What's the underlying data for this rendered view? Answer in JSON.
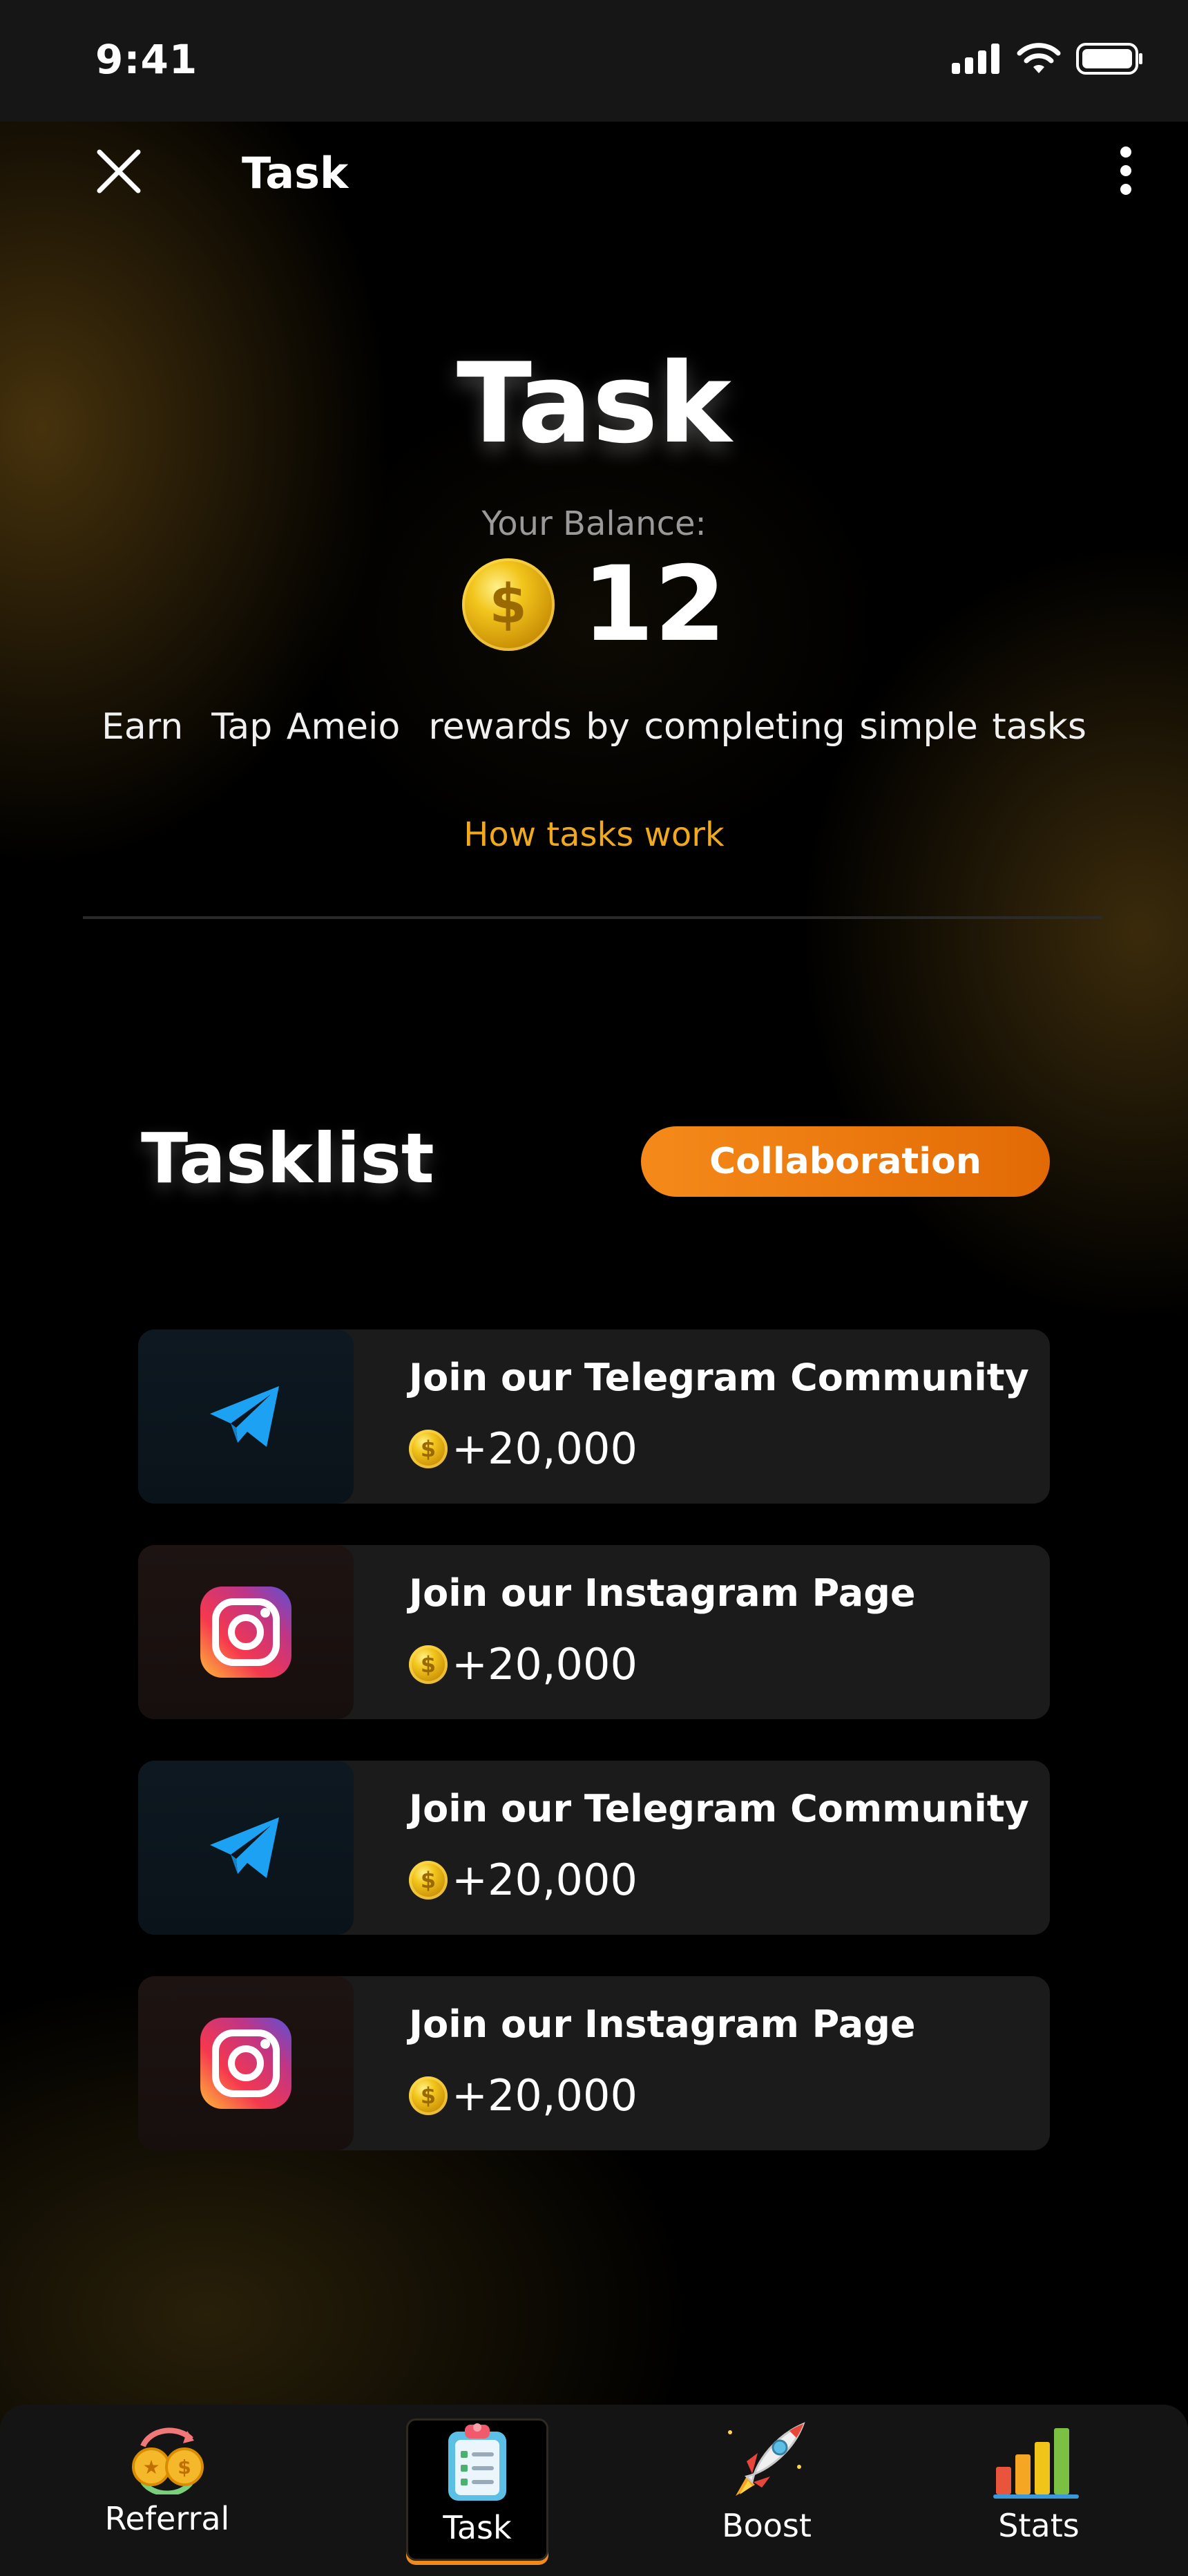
{
  "status_bar": {
    "time": "9:41"
  },
  "header": {
    "title": "Task"
  },
  "hero": {
    "title": "Task",
    "balance_label": "Your Balance:",
    "balance_value": "12",
    "subtitle": "Earn  Tap Ameio  rewards by completing simple tasks",
    "how_link": "How tasks work"
  },
  "tasklist": {
    "title": "Tasklist",
    "filter_label": "Collaboration",
    "items": [
      {
        "icon": "telegram-icon",
        "title": "Join our Telegram Community",
        "reward": "+20,000"
      },
      {
        "icon": "instagram-icon",
        "title": "Join our Instagram Page",
        "reward": "+20,000"
      },
      {
        "icon": "telegram-icon",
        "title": "Join our Telegram Community",
        "reward": "+20,000"
      },
      {
        "icon": "instagram-icon",
        "title": "Join our Instagram Page",
        "reward": "+20,000"
      }
    ]
  },
  "bottom_nav": {
    "items": [
      {
        "label": "Referral",
        "icon": "referral-coins-icon"
      },
      {
        "label": "Task",
        "icon": "clipboard-icon",
        "active": true
      },
      {
        "label": "Boost",
        "icon": "rocket-icon"
      },
      {
        "label": "Stats",
        "icon": "bar-chart-icon"
      }
    ]
  },
  "colors": {
    "accent": "#f08a1a",
    "link": "#f0a81c",
    "telegram": "#1da1f2",
    "background": "#000000"
  }
}
